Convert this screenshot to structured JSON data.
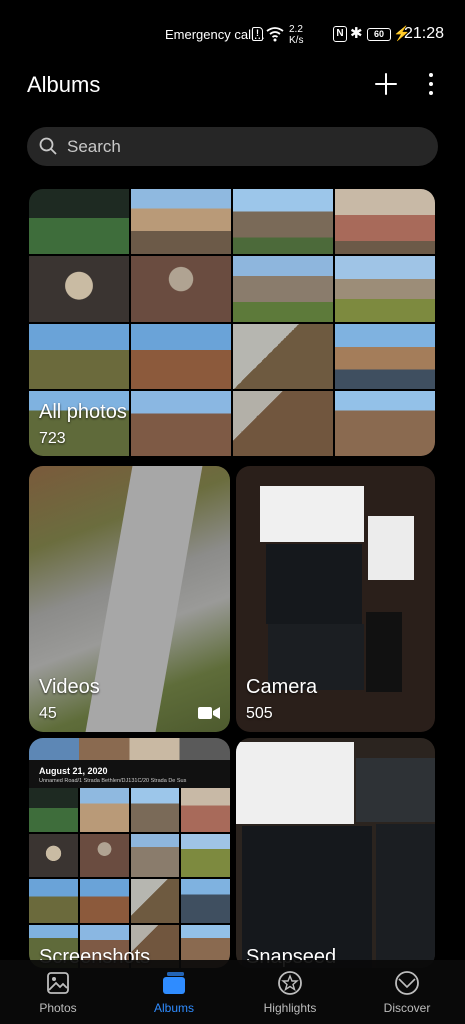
{
  "status_bar": {
    "emergency": "Emergency call...",
    "sim_icon": "sim-card-icon",
    "speed_value": "2.2",
    "speed_unit": "K/s",
    "nfc": "N",
    "battery": "60",
    "time": "21:28"
  },
  "header": {
    "title": "Albums",
    "add_icon": "plus-icon",
    "more_icon": "more-vertical-icon"
  },
  "search": {
    "placeholder": "Search"
  },
  "albums": [
    {
      "name": "All photos",
      "count": "723"
    },
    {
      "name": "Videos",
      "count": "45"
    },
    {
      "name": "Camera",
      "count": "505"
    },
    {
      "name": "Screenshots",
      "count": ""
    },
    {
      "name": "Snapseed",
      "count": ""
    }
  ],
  "screenshot_preview": {
    "date": "August 21, 2020",
    "location": "Unnamed Road/1 Strada Bethlen/DJ131C/20 Strada De Sus"
  },
  "bottom_nav": [
    {
      "label": "Photos",
      "icon": "image-icon",
      "active": false
    },
    {
      "label": "Albums",
      "icon": "albums-icon",
      "active": true
    },
    {
      "label": "Highlights",
      "icon": "star-icon",
      "active": false
    },
    {
      "label": "Discover",
      "icon": "discover-icon",
      "active": false
    }
  ],
  "colors": {
    "background": "#000000",
    "accent": "#2f8cff",
    "search_bg": "#262626"
  }
}
